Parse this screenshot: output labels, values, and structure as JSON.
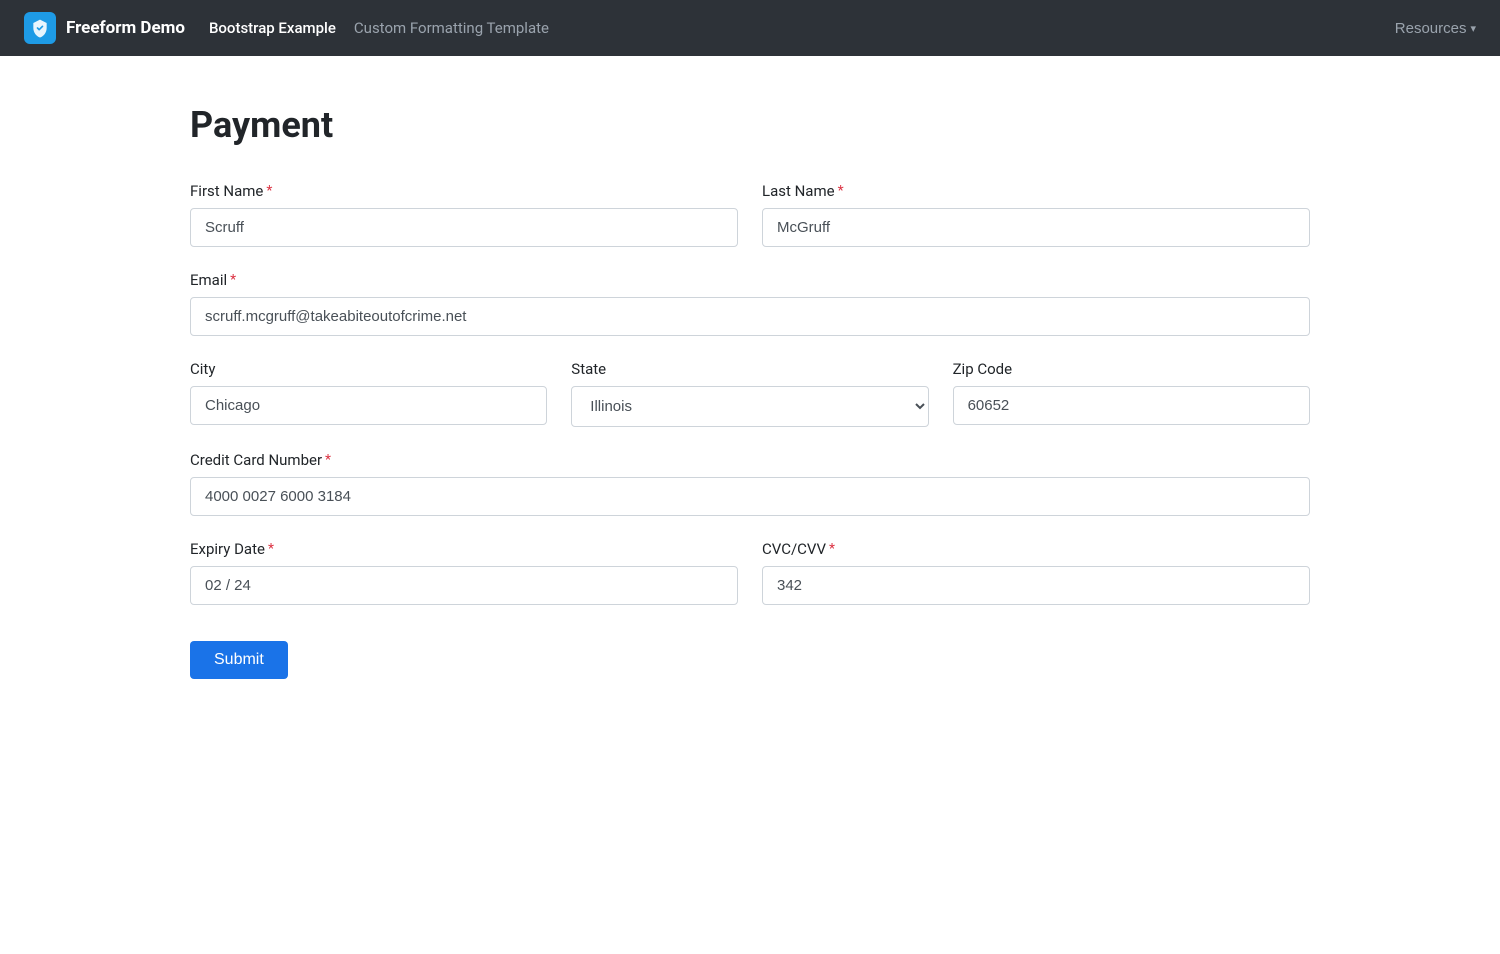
{
  "navbar": {
    "brand_name": "Freeform Demo",
    "nav_link_1": "Bootstrap Example",
    "nav_link_2": "Custom Formatting Template",
    "resources_label": "Resources"
  },
  "page": {
    "title": "Payment"
  },
  "form": {
    "first_name_label": "First Name",
    "first_name_value": "Scruff",
    "last_name_label": "Last Name",
    "last_name_value": "McGruff",
    "email_label": "Email",
    "email_value": "scruff.mcgruff@takeabiteoutofcrime.net",
    "city_label": "City",
    "city_value": "Chicago",
    "state_label": "State",
    "state_value": "Illinois",
    "zip_label": "Zip Code",
    "zip_value": "60652",
    "cc_label": "Credit Card Number",
    "cc_value": "4000 0027 6000 3184",
    "expiry_label": "Expiry Date",
    "expiry_value": "02 / 24",
    "cvc_label": "CVC/CVV",
    "cvc_value": "342",
    "submit_label": "Submit",
    "required_symbol": "*"
  }
}
